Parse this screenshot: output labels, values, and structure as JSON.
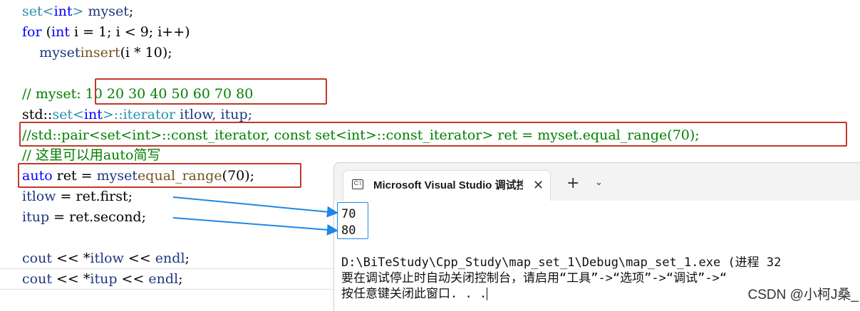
{
  "code": {
    "l1": {
      "a": "set",
      "b": "<",
      "c": "int",
      "d": "> ",
      "e": "myset",
      ";": ";"
    },
    "l2": {
      "a": "for",
      " b": " (",
      "c": "int",
      "d": " i = 1; i < 9; i++)"
    },
    "l3": {
      "a": "    ",
      "b": "myset",
      ".": ".",
      "c": "insert",
      "d": "(i * 10);"
    },
    "l5": "// myset: 10 20 30 40 50 60 70 80",
    "l6": {
      "a": "std::",
      "b": "set",
      "c": "<",
      "d": "int",
      "e": ">::",
      "f": "iterator",
      "g": " itlow, itup;"
    },
    "l7": "//std::pair<set<int>::const_iterator, const set<int>::const_iterator> ret = myset.equal_range(70);",
    "l8": "// 这里可以用auto简写",
    "l9": {
      "a": "auto",
      "b": " ret = ",
      "c": "myset",
      ".": ".",
      "d": "equal_range",
      "e": "(70);"
    },
    "l10": {
      "a": "itlow",
      "b": " = ret.first;"
    },
    "l11": {
      "a": "itup",
      "b": " = ret.second;"
    },
    "l13": {
      "a": "cout",
      "b": " << *",
      "c": "itlow",
      "d": " << ",
      "e": "endl",
      ";": ";"
    },
    "l14": {
      "a": "cout",
      "b": " << *",
      "c": "itup",
      "d": " << ",
      "e": "endl",
      ";": ";"
    }
  },
  "terminal": {
    "tab_title": "Microsoft Visual Studio 调试控",
    "close_glyph": "✕",
    "add_glyph": "+",
    "dropdown_glyph": "⌄",
    "icon_glyph": "C:\\",
    "output": [
      "70",
      "80"
    ],
    "path_line": "D:\\BiTeStudy\\Cpp_Study\\map_set_1\\Debug\\map_set_1.exe (进程 32",
    "hint_line": "要在调试停止时自动关闭控制台，请启用“工具”->“选项”->“调试”->“",
    "press_line": "按任意键关闭此窗口. . ."
  },
  "watermark": "CSDN @小柯J桑_",
  "colors": {
    "keyword": "#0000ff",
    "type": "#2b91af",
    "variable": "#1f377f",
    "function": "#74531f",
    "comment": "#008000",
    "highlight_box": "#c0392b",
    "arrow": "#1e88e5"
  }
}
